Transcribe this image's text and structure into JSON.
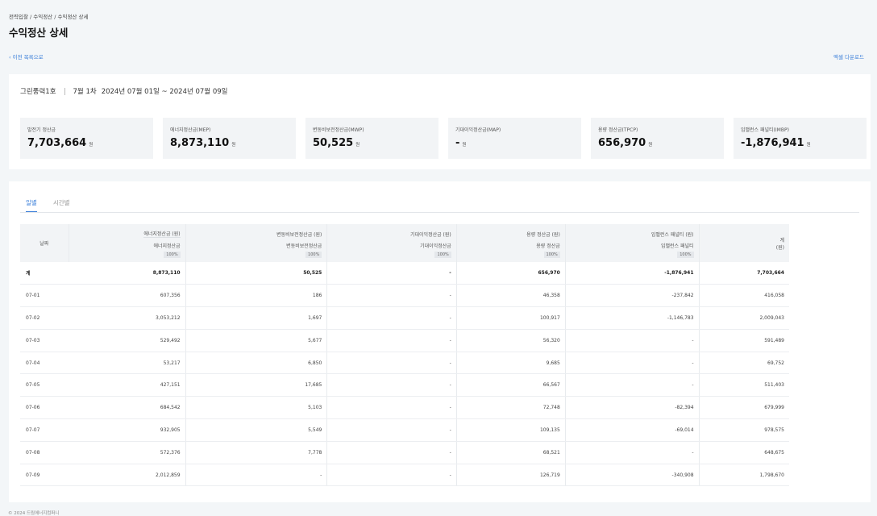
{
  "breadcrumb": "전력입찰 / 수익정산 / 수익정산 상세",
  "title": "수익정산 상세",
  "back_label": "‹  이전 목록으로",
  "excel_label": "엑셀 다운로드",
  "info": {
    "plant": "그린풍력1호",
    "period_label": "7월 1차",
    "date_range": "2024년 07월 01일 ~ 2024년 07월 09일"
  },
  "summary": [
    {
      "label": "발전기 정산금",
      "value": "7,703,664",
      "unit": "원"
    },
    {
      "label": "에너지정산금(MEP)",
      "value": "8,873,110",
      "unit": "원"
    },
    {
      "label": "변동비보전정산금(MWP)",
      "value": "50,525",
      "unit": "원"
    },
    {
      "label": "기대이익정산금(MAP)",
      "value": "-",
      "unit": "원"
    },
    {
      "label": "용량 정산금(TPCP)",
      "value": "656,970",
      "unit": "원"
    },
    {
      "label": "임밸런스 패널티(IMBP)",
      "value": "-1,876,941",
      "unit": "원"
    }
  ],
  "tabs": [
    "일별",
    "시간별"
  ],
  "table": {
    "date_header": "날짜",
    "groups": [
      {
        "title": "에너지정산금 (원)",
        "sub": "에너지정산금",
        "pct": "100%"
      },
      {
        "title": "변동비보전정산금 (원)",
        "sub": "변동비보전정산금",
        "pct": "100%"
      },
      {
        "title": "기대이익정산금 (원)",
        "sub": "기대이익정산금",
        "pct": "100%"
      },
      {
        "title": "용량 정산금 (원)",
        "sub": "용량 정산금",
        "pct": "100%"
      },
      {
        "title": "임밸런스 패널티 (원)",
        "sub": "임밸런스 패널티",
        "pct": "100%"
      }
    ],
    "total_header": "계",
    "total_unit": "(원)",
    "rows": [
      [
        "계",
        "8,873,110",
        "50,525",
        "-",
        "656,970",
        "-1,876,941",
        "7,703,664"
      ],
      [
        "07-01",
        "607,356",
        "186",
        "-",
        "46,358",
        "-237,842",
        "416,058"
      ],
      [
        "07-02",
        "3,053,212",
        "1,697",
        "-",
        "100,917",
        "-1,146,783",
        "2,009,043"
      ],
      [
        "07-03",
        "529,492",
        "5,677",
        "-",
        "56,320",
        "-",
        "591,489"
      ],
      [
        "07-04",
        "53,217",
        "6,850",
        "-",
        "9,685",
        "-",
        "69,752"
      ],
      [
        "07-05",
        "427,151",
        "17,685",
        "-",
        "66,567",
        "-",
        "511,403"
      ],
      [
        "07-06",
        "684,542",
        "5,103",
        "-",
        "72,748",
        "-82,394",
        "679,999"
      ],
      [
        "07-07",
        "932,905",
        "5,549",
        "-",
        "109,135",
        "-69,014",
        "978,575"
      ],
      [
        "07-08",
        "572,376",
        "7,778",
        "-",
        "68,521",
        "-",
        "648,675"
      ],
      [
        "07-09",
        "2,012,859",
        "-",
        "-",
        "126,719",
        "-340,908",
        "1,798,670"
      ]
    ]
  },
  "copyright": "© 2024 드림에너지컴퍼니"
}
